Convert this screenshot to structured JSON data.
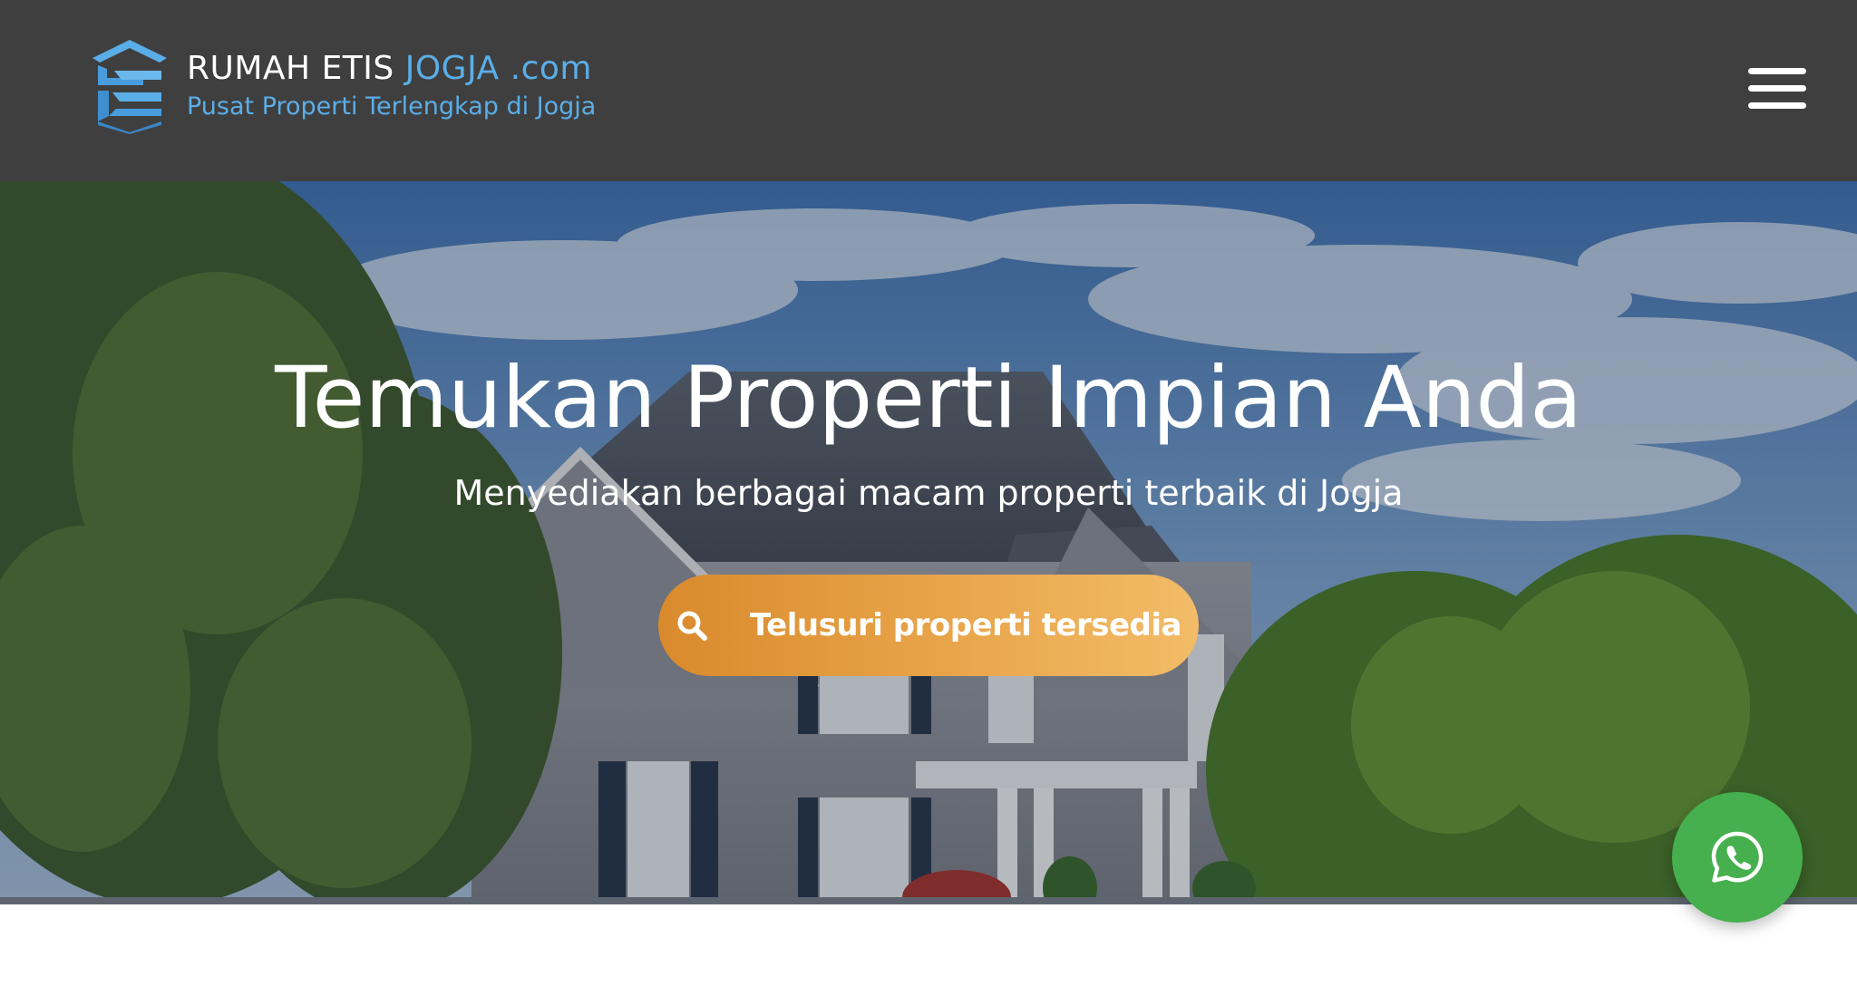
{
  "header": {
    "brand": {
      "title_part1": "RUMAH ETIS ",
      "title_part2": "JOGJA",
      "title_part3": " .com",
      "tagline": "Pusat Properti Terlengkap di Jogja",
      "logo_icon": "house-logo-icon"
    },
    "menu_icon": "hamburger-menu-icon"
  },
  "hero": {
    "title": "Temukan Properti Impian Anda",
    "subtitle": "Menyediakan berbagai macam properti terbaik di Jogja",
    "cta": {
      "label": "Telusuri properti tersedia",
      "icon": "search-icon"
    },
    "background_image": "house-photo"
  },
  "floating": {
    "whatsapp_icon": "whatsapp-icon"
  },
  "colors": {
    "header_bg": "#3f3f3f",
    "brand_accent": "#5aaee8",
    "cta_gradient_start": "#d98a2c",
    "cta_gradient_end": "#f2bc68",
    "whatsapp_green": "#45b04d"
  }
}
